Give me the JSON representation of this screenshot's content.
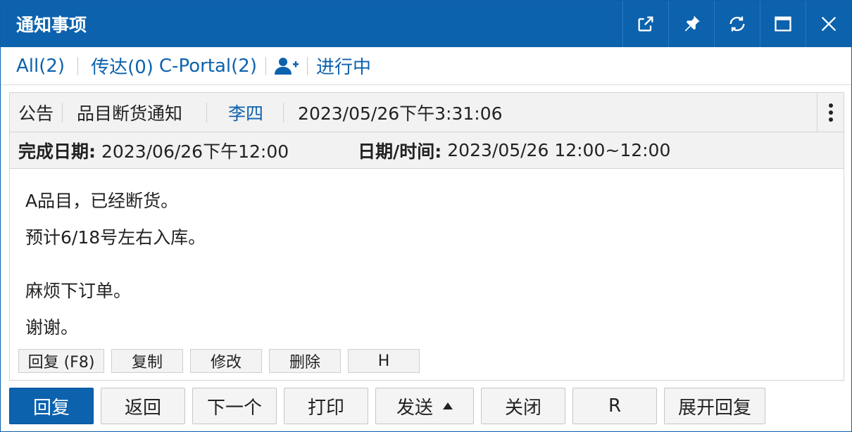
{
  "window": {
    "title": "通知事项"
  },
  "titlebar_icons": [
    "external-link-icon",
    "pin-icon",
    "refresh-icon",
    "maximize-icon",
    "close-icon"
  ],
  "filters": {
    "all": "All(2)",
    "relay": "传达(0)",
    "cportal": "C-Portal(2)",
    "add_person_icon": "person-add-icon",
    "in_progress": "进行中"
  },
  "message": {
    "category": "公告",
    "subject": "品目断货通知",
    "author": "李四",
    "timestamp": "2023/05/26下午3:31:06",
    "due_label": "完成日期:",
    "due_value": "2023/06/26下午12:00",
    "datetime_label": "日期/时间:",
    "datetime_value": "2023/05/26 12:00~12:00",
    "body": {
      "line1": "A品目，已经断货。",
      "line2": "预计6/18号左右入库。",
      "line3": "麻烦下订单。",
      "line4": "谢谢。"
    }
  },
  "inline_buttons": {
    "reply": "回复 (F8)",
    "copy": "复制",
    "edit": "修改",
    "delete": "删除",
    "h": "H"
  },
  "actions": {
    "reply": "回复",
    "back": "返回",
    "next": "下一个",
    "print": "打印",
    "send": "发送",
    "close": "关闭",
    "r": "R",
    "expand_reply": "展开回复"
  },
  "colors": {
    "brand": "#0c62ad",
    "link": "#0c62ad",
    "header_bg": "#f2f2f2"
  }
}
